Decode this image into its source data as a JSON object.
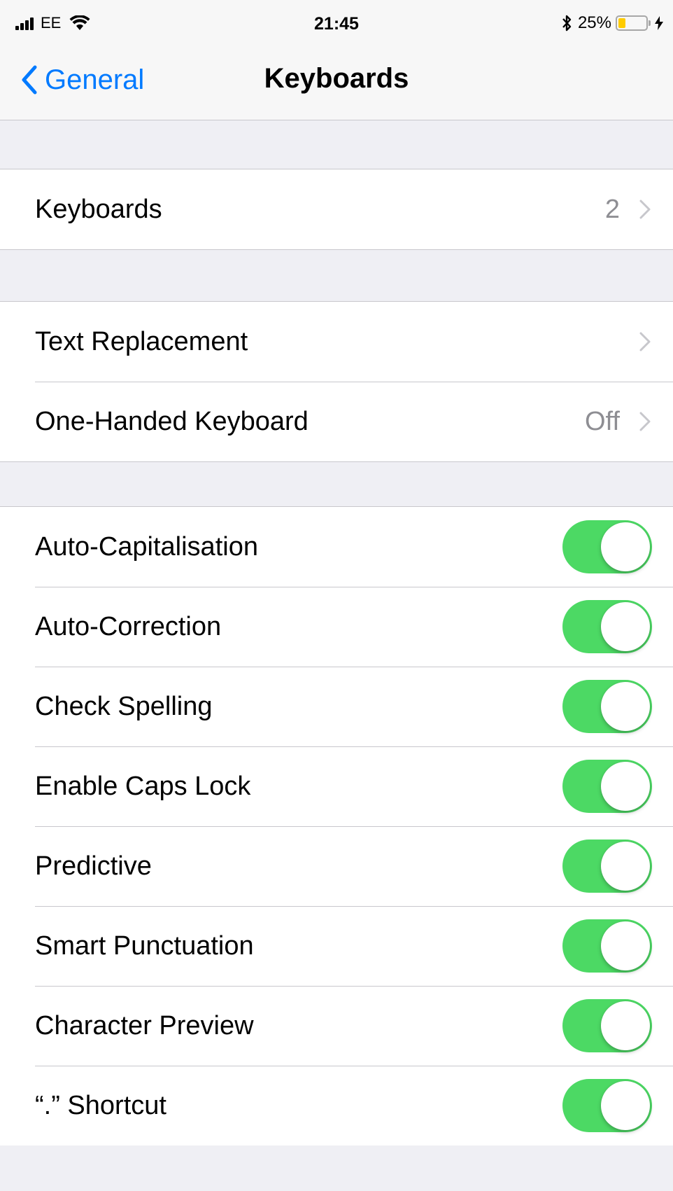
{
  "status_bar": {
    "carrier": "EE",
    "time": "21:45",
    "battery_percent_label": "25%",
    "battery_level": 0.25
  },
  "nav": {
    "back_label": "General",
    "title": "Keyboards"
  },
  "groups": {
    "keyboards": {
      "label": "Keyboards",
      "value": "2"
    },
    "text_replacement": {
      "label": "Text Replacement"
    },
    "one_handed": {
      "label": "One-Handed Keyboard",
      "value": "Off"
    }
  },
  "toggles": [
    {
      "label": "Auto-Capitalisation",
      "on": true
    },
    {
      "label": "Auto-Correction",
      "on": true
    },
    {
      "label": "Check Spelling",
      "on": true
    },
    {
      "label": "Enable Caps Lock",
      "on": true
    },
    {
      "label": "Predictive",
      "on": true
    },
    {
      "label": "Smart Punctuation",
      "on": true
    },
    {
      "label": "Character Preview",
      "on": true
    },
    {
      "label": "“.” Shortcut",
      "on": true
    }
  ],
  "colors": {
    "accent": "#007aff",
    "toggle_on": "#4cd964",
    "background": "#efeff4"
  }
}
